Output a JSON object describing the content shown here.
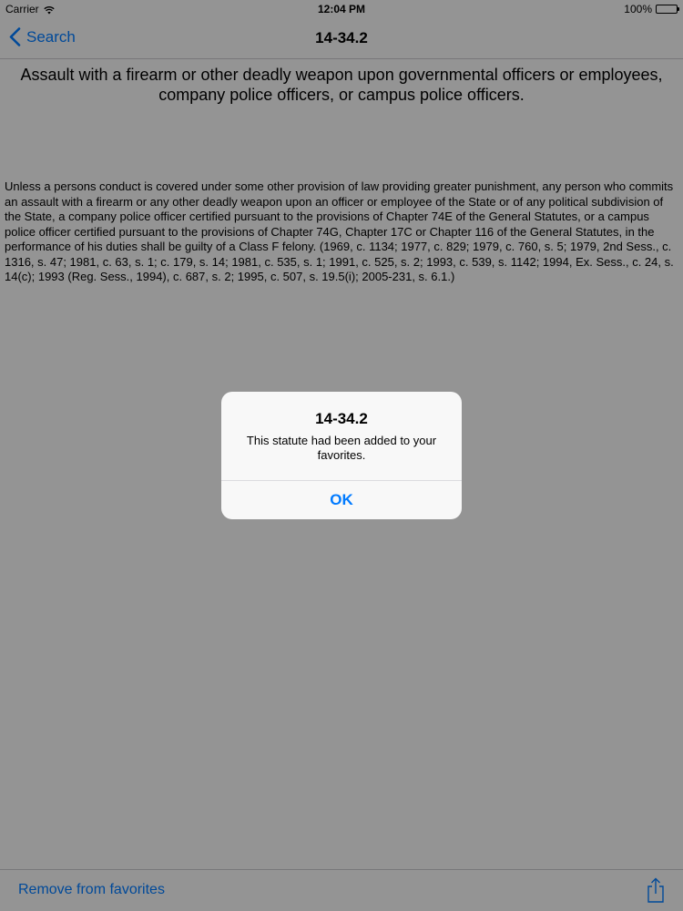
{
  "status_bar": {
    "carrier": "Carrier",
    "time": "12:04 PM",
    "battery": "100%"
  },
  "nav": {
    "back_label": "Search",
    "title": "14-34.2"
  },
  "statute": {
    "heading": "Assault with a firearm or other deadly weapon upon governmental officers or employees, company police officers, or campus police officers.",
    "body": "Unless a persons conduct is covered under some other provision of law providing greater punishment, any person who commits an assault with a firearm or any other deadly weapon upon an officer or employee of the State or of any political subdivision of the State, a company police officer certified pursuant to the provisions of Chapter 74E of the General Statutes, or a campus police officer certified pursuant to the provisions of Chapter 74G, Chapter 17C or Chapter 116 of the General Statutes, in the performance of his duties shall be guilty of a Class F felony. (1969, c. 1134; 1977, c. 829; 1979, c. 760, s. 5; 1979, 2nd Sess., c. 1316, s. 47; 1981, c. 63, s. 1; c. 179, s. 14; 1981, c. 535, s. 1; 1991, c. 525, s. 2; 1993, c. 539, s. 1142; 1994, Ex. Sess., c. 24, s. 14(c); 1993 (Reg. Sess., 1994), c. 687, s. 2; 1995, c. 507, s. 19.5(i); 2005-231, s. 6.1.)"
  },
  "toolbar": {
    "remove_label": "Remove from favorites",
    "share_icon": "share-icon"
  },
  "alert": {
    "title": "14-34.2",
    "message": "This statute had been added to your favorites.",
    "ok_label": "OK"
  },
  "colors": {
    "accent": "#007aff",
    "overlay": "rgba(0,0,0,0.4)"
  }
}
